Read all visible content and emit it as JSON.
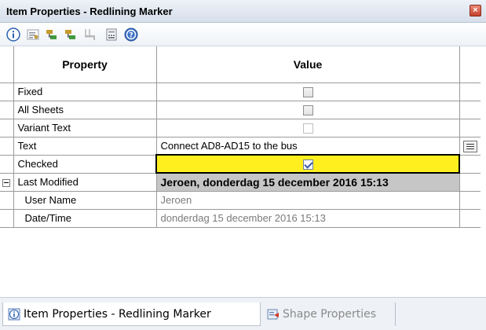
{
  "window": {
    "title": "Item Properties - Redlining Marker"
  },
  "colors": {
    "checked_highlight": "#ffef1e",
    "last_modified_bg": "#c6c6c6",
    "close_button": "#c5412a"
  },
  "toolbar": {
    "icons": [
      "info-icon",
      "categorized-icon",
      "add-property-icon",
      "remove-property-icon",
      "connector-icon",
      "calculator-icon",
      "help-icon"
    ]
  },
  "grid": {
    "header": {
      "property": "Property",
      "value": "Value"
    },
    "rows": [
      {
        "property": "Fixed",
        "type": "checkbox",
        "checked": false
      },
      {
        "property": "All Sheets",
        "type": "checkbox",
        "checked": false
      },
      {
        "property": "Variant Text",
        "type": "checkbox",
        "checked": false
      },
      {
        "property": "Text",
        "value": "Connect AD8-AD15 to the bus"
      },
      {
        "property": "Checked",
        "type": "checkbox",
        "checked": true
      },
      {
        "property": "Last Modified",
        "value": "Jeroen, donderdag 15 december 2016 15:13"
      },
      {
        "property": "User Name",
        "value": "Jeroen"
      },
      {
        "property": "Date/Time",
        "value": "donderdag 15 december 2016 15:13"
      }
    ]
  },
  "tabs": [
    {
      "label": "Item Properties - Redlining Marker",
      "active": true
    },
    {
      "label": "Shape Properties",
      "active": false
    }
  ]
}
